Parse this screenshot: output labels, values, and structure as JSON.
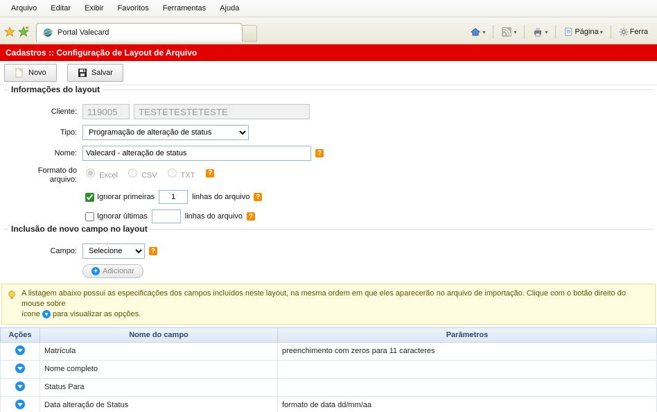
{
  "menu": {
    "items": [
      "Arquivo",
      "Editar",
      "Exibir",
      "Favoritos",
      "Ferramentas",
      "Ajuda"
    ]
  },
  "tab": {
    "title": "Portal Valecard"
  },
  "toolbar_right": {
    "pagina_label": "Página",
    "ferramentas_label": "Ferra"
  },
  "header": {
    "title": "Cadastros :: Configuração de Layout de Arquivo"
  },
  "actions": {
    "novo": "Novo",
    "salvar": "Salvar"
  },
  "layout_info": {
    "legend": "Informações do layout",
    "cliente_label": "Cliente:",
    "cliente_code": "119005",
    "cliente_name": "TESTETESTETESTE",
    "tipo_label": "Tipo:",
    "tipo_value": "Programação de alteração de status",
    "nome_label": "Nome:",
    "nome_value": "Valecard - alteração de status",
    "formato_label": "Formato do arquivo:",
    "formato_excel": "Excel",
    "formato_csv": "CSV",
    "formato_txt": "TXT",
    "ignorar_primeiras_label": "Ignorar primeiras",
    "ignorar_primeiras_value": "1",
    "linhas_do_arquivo": "linhas do arquivo",
    "ignorar_ultimas_label": "Ignorar últimas",
    "ignorar_ultimas_value": ""
  },
  "new_field": {
    "legend": "Inclusão de novo campo no layout",
    "campo_label": "Campo:",
    "campo_value": "Selecione",
    "adicionar_label": "Adicionar"
  },
  "banner": {
    "text_before": "A listagem abaixo possui as especificações dos campos incluídos neste layout, na mesma ordem em que eles aparecerão no arquivo de importação. Clique com o botão direito do mouse sobre",
    "text_mid_a": "ícone ",
    "text_mid_b": " para visualizar as opções."
  },
  "table": {
    "headers": {
      "acoes": "Ações",
      "nome": "Nome do campo",
      "parametros": "Parâmetros"
    },
    "rows": [
      {
        "nome": "Matrícula",
        "parametros": "preenchimento com zeros para 11 caracteres"
      },
      {
        "nome": "Nome completo",
        "parametros": ""
      },
      {
        "nome": "Status Para",
        "parametros": ""
      },
      {
        "nome": "Data alteração de Status",
        "parametros": "formato de data dd/mm/aa"
      }
    ]
  }
}
